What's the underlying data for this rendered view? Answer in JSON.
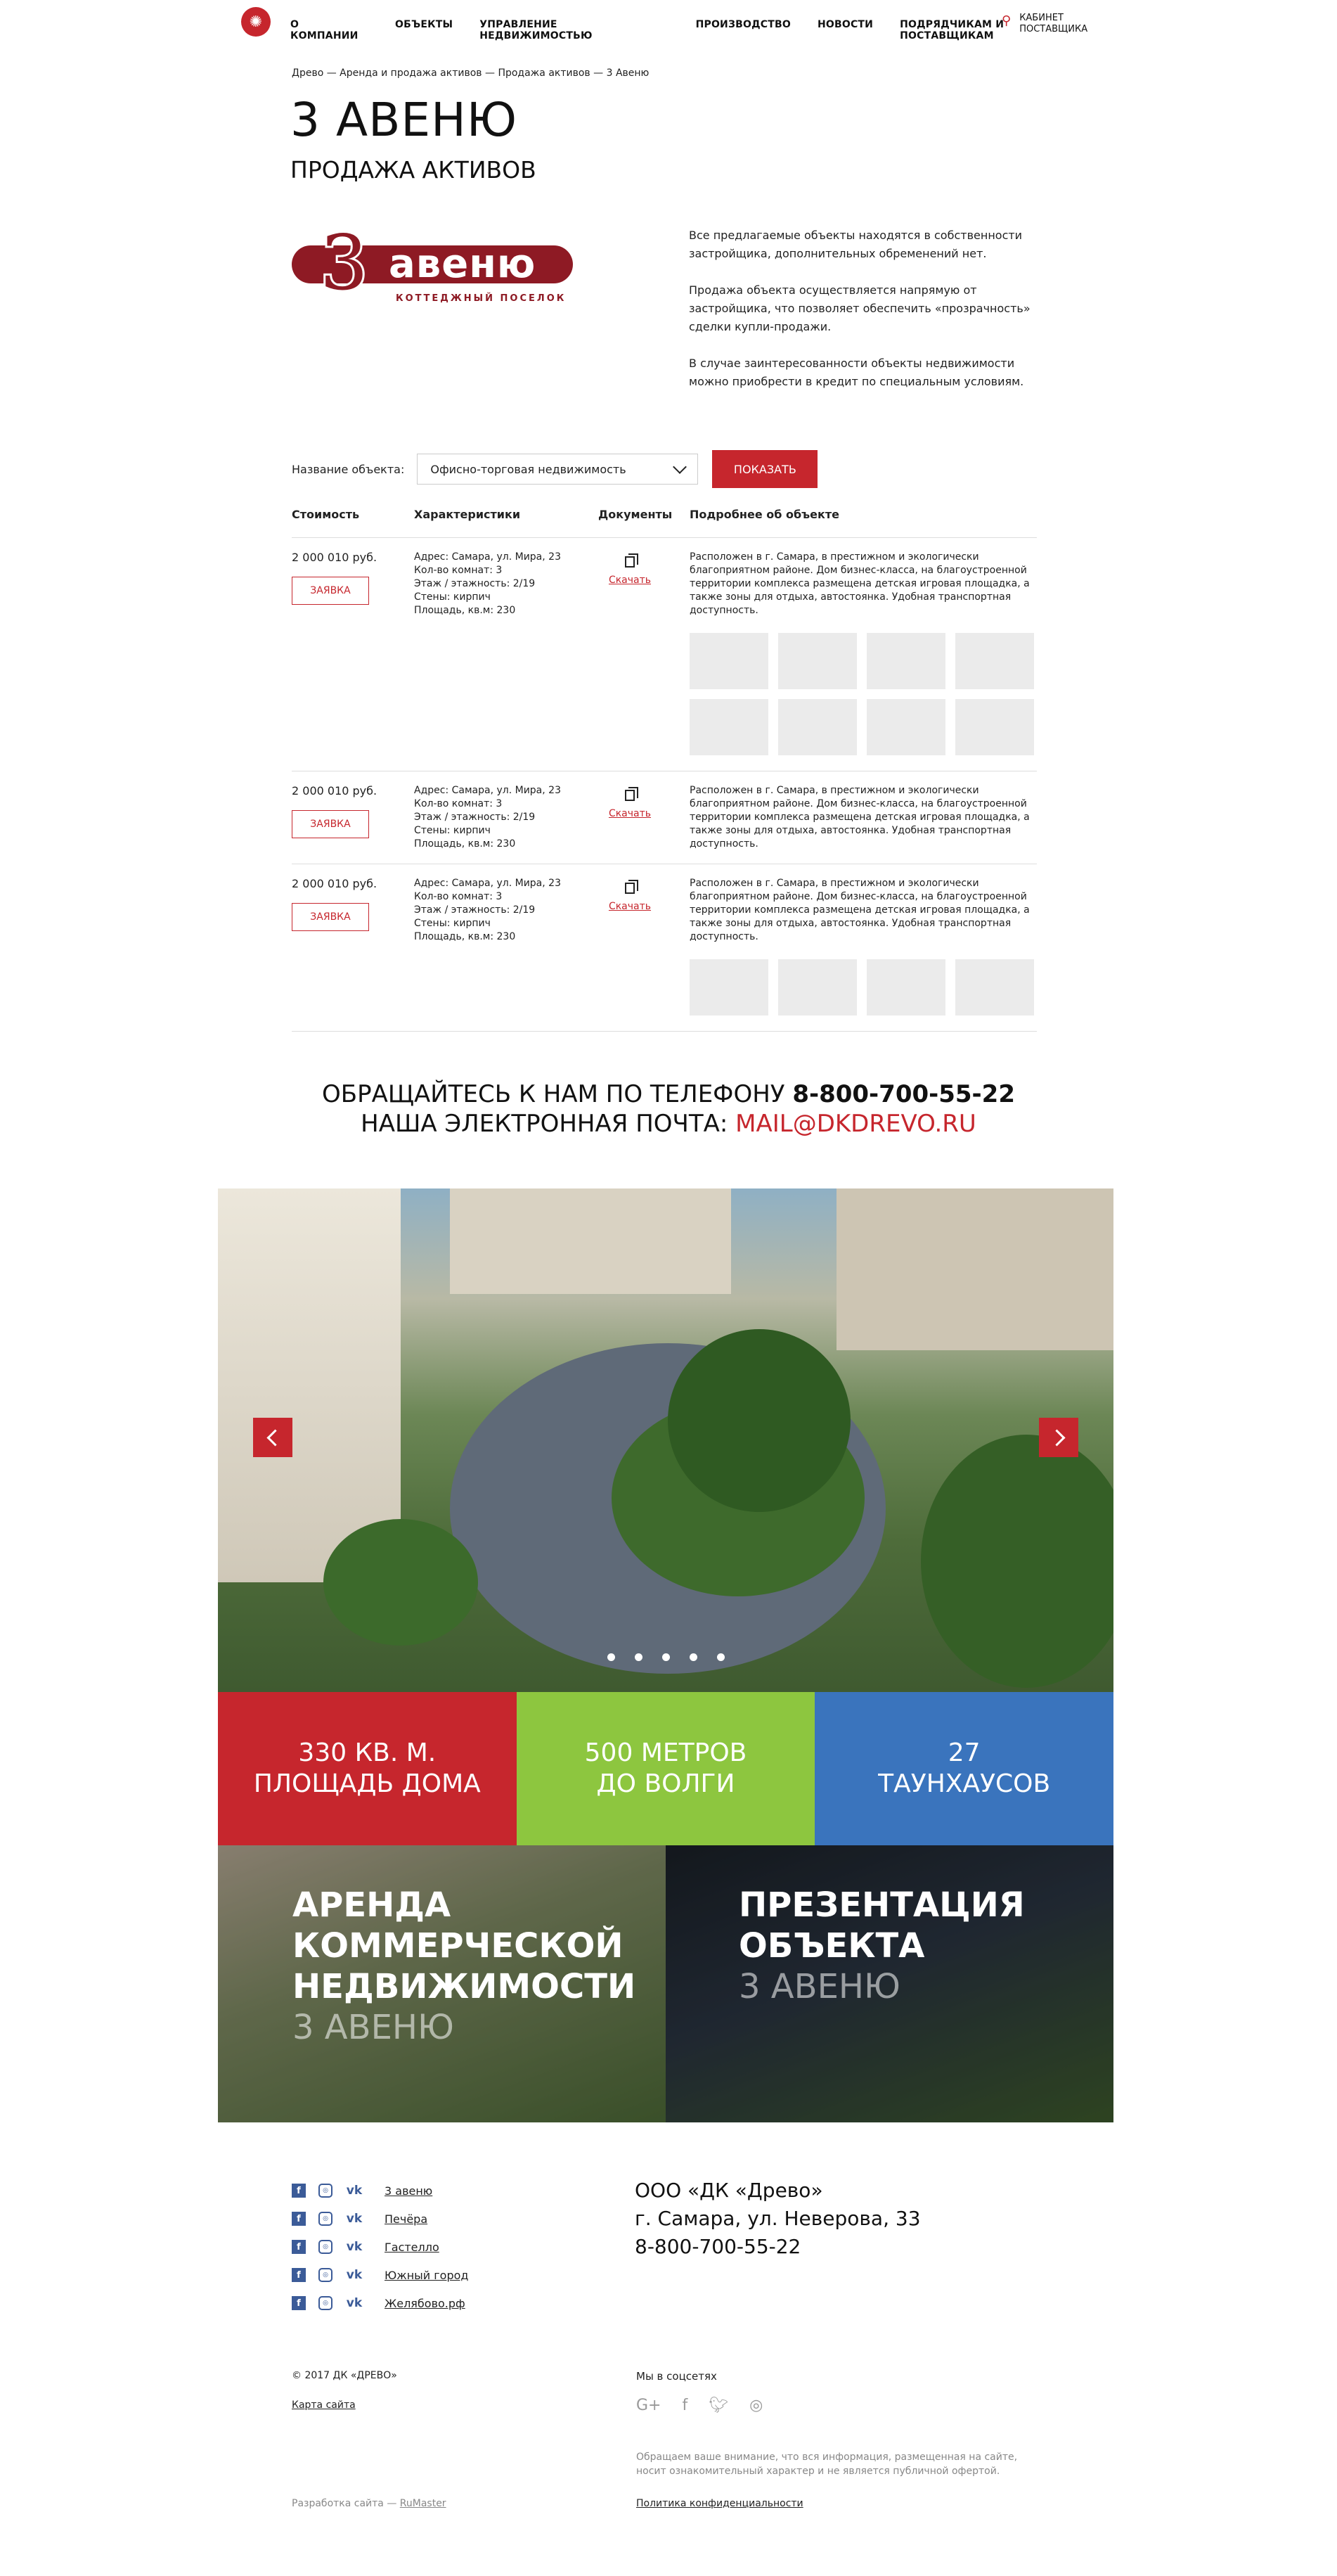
{
  "header": {
    "nav": [
      "О КОМПАНИИ",
      "ОБЪЕКТЫ",
      "УПРАВЛЕНИЕ НЕДВИЖИМОСТЬЮ",
      "ПРОИЗВОДСТВО",
      "НОВОСТИ",
      "ПОДРЯДЧИКАМ И ПОСТАВЩИКАМ"
    ],
    "cabinet_line1": "КАБИНЕТ",
    "cabinet_line2": "ПОСТАВЩИКА"
  },
  "breadcrumbs": [
    "Древо",
    "Аренда и продажа активов",
    "Продажа активов",
    "3 Авеню"
  ],
  "breadcrumb_sep": " — ",
  "page": {
    "title": "3 АВЕНЮ",
    "subtitle": "ПРОДАЖА АКТИВОВ"
  },
  "brand": {
    "number": "3",
    "word": "авеню",
    "tagline": "КОТТЕДЖНЫЙ ПОСЕЛОК"
  },
  "intro": [
    "Все предлагаемые объекты находятся в собственности застройщика, дополнительных обременений нет.",
    "Продажа объекта осуществляется напрямую от застройщика, что позволяет обеспечить «прозрачность» сделки купли-продажи.",
    "В случае заинтересованности объекты недвижимости можно приобрести в кредит по специальным условиям."
  ],
  "filter": {
    "label": "Название объекта:",
    "selected": "Офисно-торговая недвижимость",
    "button": "ПОКАЗАТЬ"
  },
  "table": {
    "headers": [
      "Стоимость",
      "Характеристики",
      "Документы",
      "Подробнее об объекте"
    ],
    "apply_label": "ЗАЯВКА",
    "download_label": "Скачать",
    "rows": [
      {
        "price": "2 000 010 руб.",
        "specs": [
          "Адрес: Самара, ул. Мира, 23",
          "Кол-во комнат: 3",
          "Этаж / этажность: 2/19",
          "Стены: кирпич",
          "Площадь, кв.м: 230"
        ],
        "desc": "Расположен в г. Самара, в престижном и экологически благоприятном районе. Дом бизнес-класса, на благоустроенной территории комплекса размещена детская игровая площадка, а также зоны для отдыха, автостоянка. Удобная транспортная доступность."
      },
      {
        "price": "2 000 010 руб.",
        "specs": [
          "Адрес: Самара, ул. Мира, 23",
          "Кол-во комнат: 3",
          "Этаж / этажность: 2/19",
          "Стены: кирпич",
          "Площадь, кв.м: 230"
        ],
        "desc": "Расположен в г. Самара, в престижном и экологически благоприятном районе. Дом бизнес-класса, на благоустроенной территории комплекса размещена детская игровая площадка, а также зоны для отдыха, автостоянка. Удобная транспортная доступность."
      },
      {
        "price": "2 000 010 руб.",
        "specs": [
          "Адрес: Самара, ул. Мира, 23",
          "Кол-во комнат: 3",
          "Этаж / этажность: 2/19",
          "Стены: кирпич",
          "Площадь, кв.м: 230"
        ],
        "desc": "Расположен в г. Самара, в престижном и экологически благоприятном районе. Дом бизнес-класса, на благоустроенной территории комплекса размещена детская игровая площадка, а также зоны для отдыха, автостоянка. Удобная транспортная доступность."
      }
    ]
  },
  "contact": {
    "phone_prefix": "ОБРАЩАЙТЕСЬ К НАМ ПО ТЕЛЕФОНУ ",
    "phone": "8-800-700-55-22",
    "email_prefix": "НАША ЭЛЕКТРОННАЯ ПОЧТА: ",
    "email": "MAIL@DKDREVO.RU"
  },
  "stats": [
    {
      "line1": "330 КВ. М.",
      "line2": "ПЛОЩАДЬ ДОМА",
      "color": "#c6262d"
    },
    {
      "line1": "500 МЕТРОВ",
      "line2": "ДО ВОЛГИ",
      "color": "#8dc63f"
    },
    {
      "line1": "27",
      "line2": "ТАУНХАУСОВ",
      "color": "#3a74bd"
    }
  ],
  "promo": [
    {
      "lines": [
        "АРЕНДА",
        "КОММЕРЧЕСКОЙ",
        "НЕДВИЖИМОСТИ"
      ],
      "sub": "3 АВЕНЮ"
    },
    {
      "lines": [
        "ПРЕЗЕНТАЦИЯ",
        "ОБЪЕКТА"
      ],
      "sub": "3 АВЕНЮ"
    }
  ],
  "footer": {
    "projects": [
      "3 авеню",
      "Печёра",
      "Гастелло",
      "Южный город",
      "Желябово.рф"
    ],
    "company_name": "ООО «ДК «Древо»",
    "address": "г. Самара, ул. Неверова, 33",
    "phone": "8-800-700-55-22",
    "copyright": "© 2017 ДК «ДРЕВО»",
    "sitemap": "Карта сайта",
    "dev_prefix": "Разработка сайта — ",
    "dev_link": "RuMaster",
    "socials_title": "Мы в соцсетях",
    "note": "Обращаем ваше внимание, что вся информация, размещенная на сайте, носит ознакомительный характер и не является публичной офертой.",
    "policy": "Политика конфиденциальности"
  }
}
